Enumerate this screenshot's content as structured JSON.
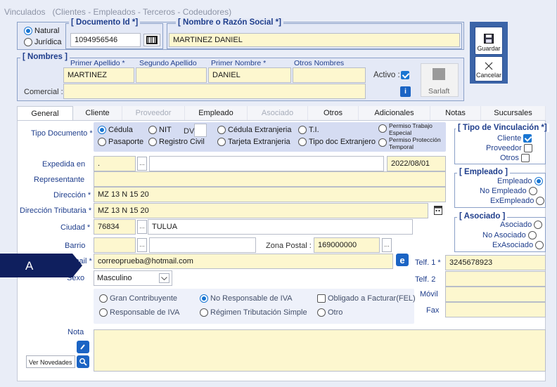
{
  "window": {
    "title": "Vinculados",
    "subtitle": "(Clientes - Empleados - Terceros - Codeudores)"
  },
  "person_type": {
    "natural": "Natural",
    "juridica": "Jurídica"
  },
  "documento": {
    "legend": "[ Documento Id *]",
    "value": "1094956546"
  },
  "razon_social": {
    "legend": "[ Nombre o Razón Social *]",
    "value": "MARTINEZ DANIEL"
  },
  "nombres": {
    "legend": "[ Nombres ]",
    "primer_apellido_label": "Primer Apellido *",
    "primer_apellido": "MARTINEZ",
    "segundo_apellido_label": "Segundo Apellido",
    "segundo_apellido": "",
    "primer_nombre_label": "Primer Nombre *",
    "primer_nombre": "DANIEL",
    "otros_nombres_label": "Otros Nombres",
    "otros_nombres": "",
    "activo_label": "Activo :",
    "comercial_label": "Comercial :",
    "comercial": "",
    "sarlaft": "Sarlaft"
  },
  "actions": {
    "guardar": "Guardar",
    "cancelar": "Cancelar"
  },
  "tabs": [
    {
      "label": "General"
    },
    {
      "label": "Cliente"
    },
    {
      "label": "Proveedor"
    },
    {
      "label": "Empleado"
    },
    {
      "label": "Asociado"
    },
    {
      "label": "Otros"
    },
    {
      "label": "Adicionales"
    },
    {
      "label": "Notas"
    },
    {
      "label": "Sucursales"
    }
  ],
  "general": {
    "tipo_documento_label": "Tipo Documento *",
    "tipos": {
      "cedula": "Cédula",
      "nit": "NIT",
      "dv": "DV",
      "cedula_extranjeria": "Cédula Extranjeria",
      "ti": "T.I.",
      "permiso_trabajo": "Permiso Trabajo Especial",
      "pasaporte": "Pasaporte",
      "registro_civil": "Registro Civil",
      "tarjeta_extranjeria": "Tarjeta Extranjeria",
      "tipo_doc_extranjero": "Tipo doc Extranjero",
      "permiso_proteccion": "Permiso Protección Temporal"
    },
    "expedida_label": "Expedida en",
    "expedida_code": ".",
    "expedida_date": "2022/08/01",
    "representante_label": "Representante",
    "direccion_label": "Dirección *",
    "direccion": "MZ 13 N 15 20",
    "direccion_trib_label": "Dirección Tributaria *",
    "direccion_trib": "MZ 13 N 15 20",
    "ciudad_label": "Ciudad *",
    "ciudad_code": "76834",
    "ciudad_name": "TULUA",
    "barrio_label": "Barrio",
    "zona_postal_label": "Zona Postal :",
    "zona_postal": "169000000",
    "email_label": "Email *",
    "email": "correoprueba@hotmail.com",
    "sexo_label": "Sexo",
    "sexo": "Masculino",
    "telf1_label": "Telf. 1 *",
    "telf1": "3245678923",
    "telf2_label": "Telf. 2",
    "movil_label": "Móvil",
    "fax_label": "Fax",
    "iva": {
      "gran_contribuyente": "Gran Contribuyente",
      "no_responsable": "No Responsable de IVA",
      "obligado_facturar": "Obligado a Facturar(FEL)",
      "responsable": "Responsable de IVA",
      "regimen_simple": "Régimen Tributación Simple",
      "otro": "Otro"
    },
    "nota_label": "Nota",
    "ver_novedades": "Ver Novedades"
  },
  "vinculacion": {
    "legend": "[ Tipo de Vinculación *]",
    "cliente": "Cliente",
    "proveedor": "Proveedor",
    "otros": "Otros"
  },
  "empleado": {
    "legend": "[ Empleado ]",
    "empleado": "Empleado",
    "no_empleado": "No Empleado",
    "ex_empleado": "ExEmpleado"
  },
  "asociado": {
    "legend": "[ Asociado ]",
    "asociado": "Asociado",
    "no_asociado": "No Asociado",
    "ex_asociado": "ExAsociado"
  },
  "callout": {
    "label": "A"
  },
  "colors": {
    "accent": "#1976d2",
    "legend": "#1f3e8c",
    "input": "#fdf7cf",
    "callout": "#0f1f5e"
  }
}
